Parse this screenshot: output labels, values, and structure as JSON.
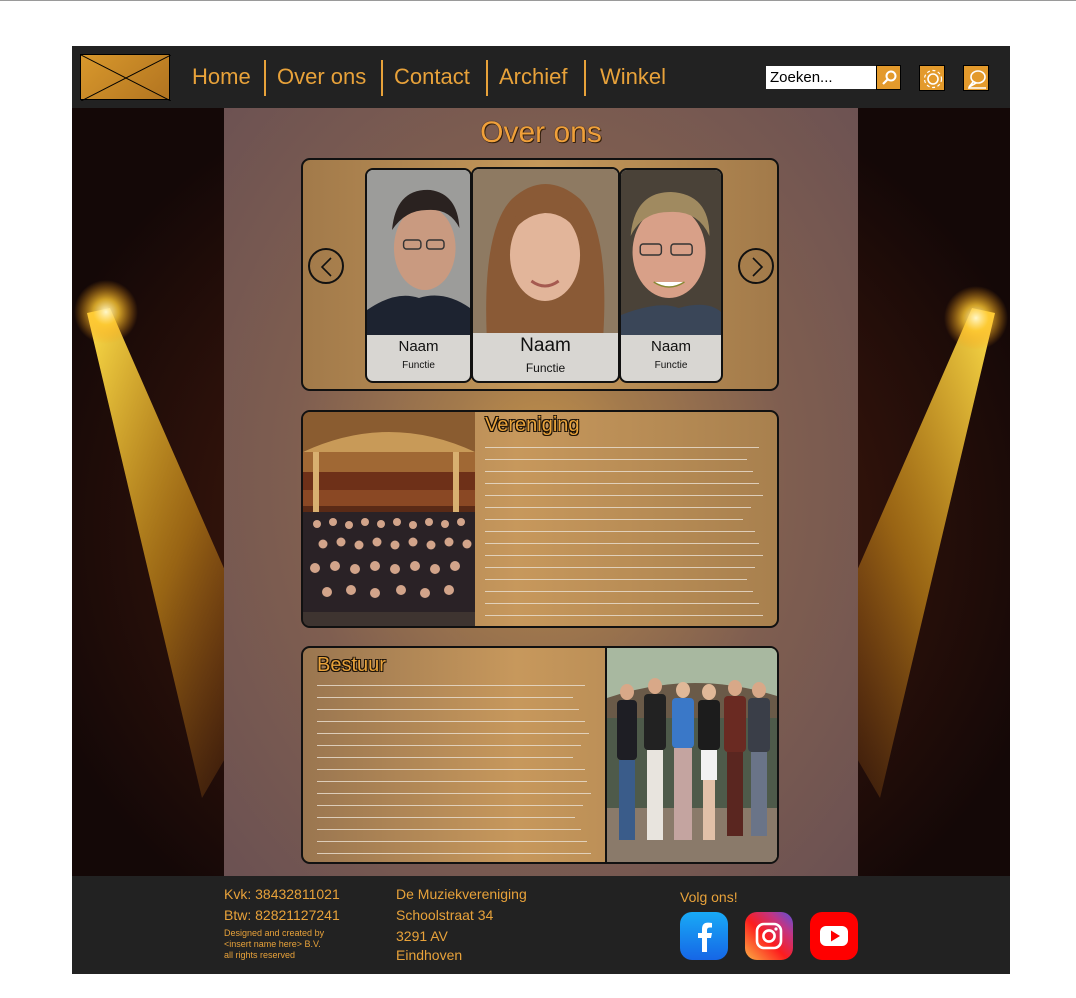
{
  "nav": {
    "items": [
      "Home",
      "Over ons",
      "Contact",
      "Archief",
      "Winkel"
    ],
    "search_placeholder": "Zoeken...",
    "icons": [
      "logo-placeholder-icon",
      "search-icon",
      "settings-icon",
      "chat-icon"
    ]
  },
  "page": {
    "title": "Over ons"
  },
  "carousel": {
    "cards": [
      {
        "name": "Naam",
        "role": "Functie"
      },
      {
        "name": "Naam",
        "role": "Functie"
      },
      {
        "name": "Naam",
        "role": "Functie"
      }
    ],
    "icons": [
      "chevron-left-icon",
      "chevron-right-icon"
    ]
  },
  "sections": {
    "vereniging": {
      "title": "Vereniging"
    },
    "bestuur": {
      "title": "Bestuur"
    }
  },
  "footer": {
    "kvk": "Kvk: 38432811021",
    "btw": "Btw: 82821127241",
    "credits": [
      "Designed and created by",
      "<insert name here> B.V.",
      "all rights reserved"
    ],
    "address": [
      "De Muziekvereniging",
      "Schoolstraat 34",
      "3291 AV",
      "Eindhoven"
    ],
    "follow": "Volg ons!",
    "social_icons": [
      "facebook-icon",
      "instagram-icon",
      "youtube-icon"
    ]
  },
  "colors": {
    "accent": "#e8a23a",
    "nav_bg": "#222222",
    "facebook": "#1877f2",
    "youtube": "#ff0000"
  }
}
